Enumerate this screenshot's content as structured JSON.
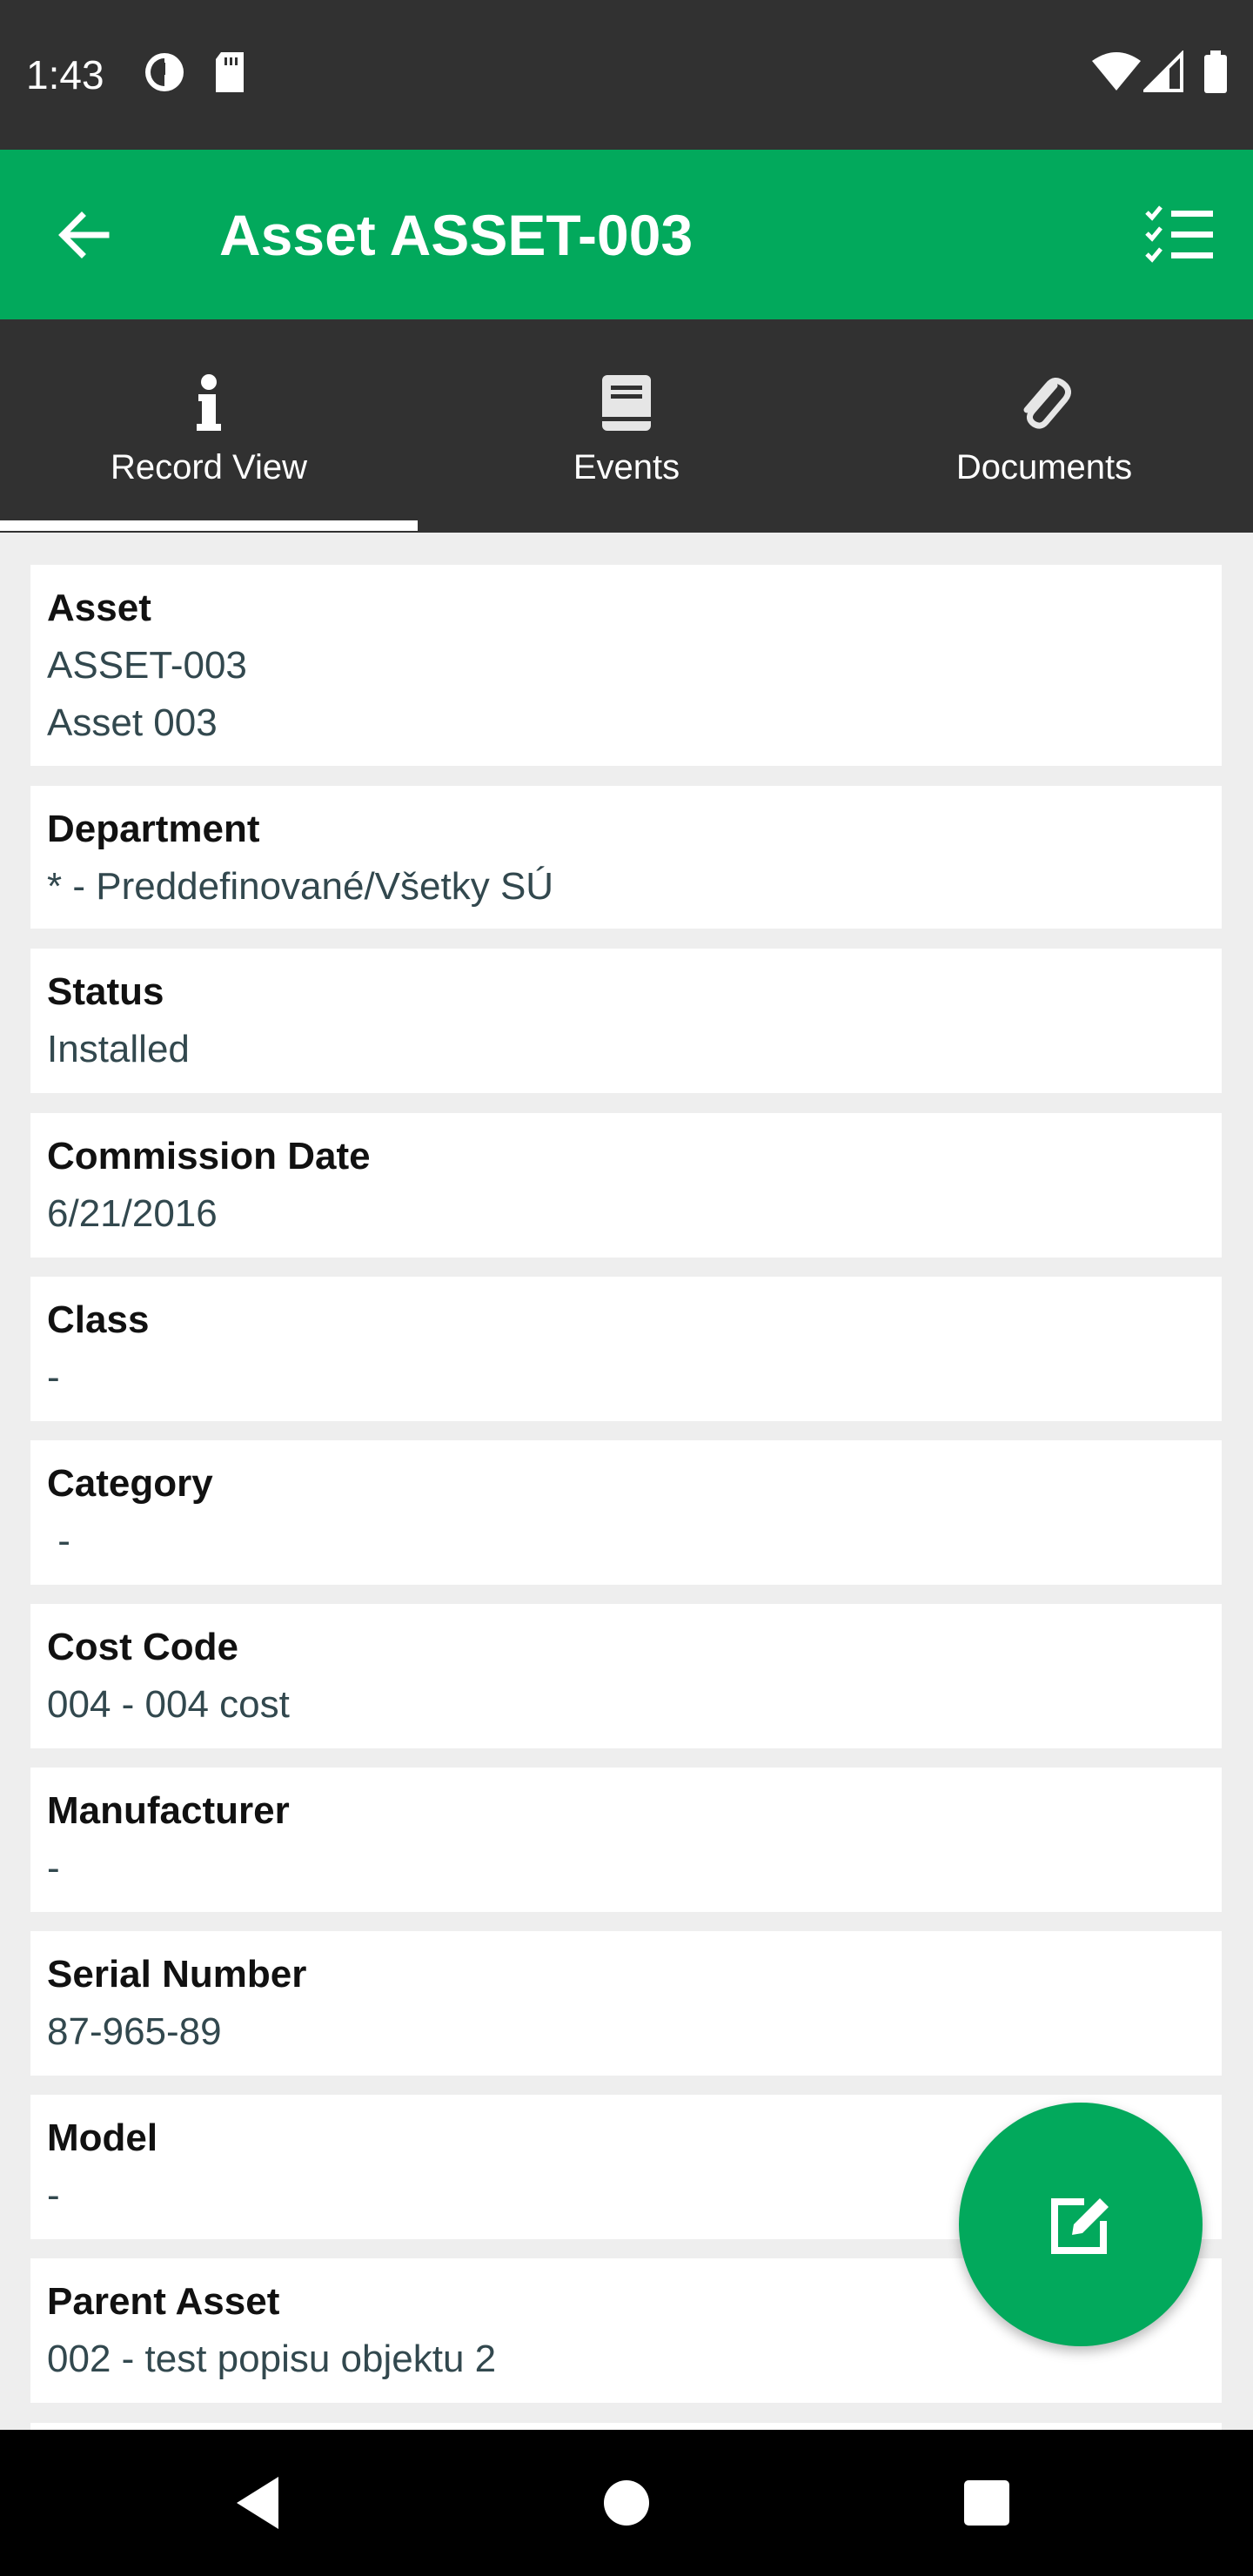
{
  "status_bar": {
    "time": "1:43"
  },
  "app_bar": {
    "title": "Asset ASSET-003",
    "color": "#02a95c"
  },
  "tabs": [
    {
      "label": "Record View",
      "icon": "info-icon",
      "selected": true
    },
    {
      "label": "Events",
      "icon": "book-icon",
      "selected": false
    },
    {
      "label": "Documents",
      "icon": "paperclip-icon",
      "selected": false
    }
  ],
  "fields": [
    {
      "label": "Asset",
      "values": [
        "ASSET-003",
        "Asset 003"
      ]
    },
    {
      "label": "Department",
      "values": [
        "* - Preddefinované/Všetky SÚ"
      ]
    },
    {
      "label": "Status",
      "values": [
        "Installed"
      ]
    },
    {
      "label": "Commission Date",
      "values": [
        "6/21/2016"
      ]
    },
    {
      "label": "Class",
      "values": [
        "-"
      ]
    },
    {
      "label": "Category",
      "values": [
        " -"
      ]
    },
    {
      "label": "Cost Code",
      "values": [
        "004 - 004 cost"
      ]
    },
    {
      "label": "Manufacturer",
      "values": [
        "-"
      ]
    },
    {
      "label": "Serial Number",
      "values": [
        "87-965-89"
      ]
    },
    {
      "label": "Model",
      "values": [
        "-"
      ]
    },
    {
      "label": "Parent Asset",
      "values": [
        "002 - test popisu objektu 2"
      ]
    }
  ],
  "fab": {
    "icon": "edit-icon"
  },
  "nav": {
    "back": "back-icon",
    "home": "home-icon",
    "recents": "recents-icon"
  }
}
